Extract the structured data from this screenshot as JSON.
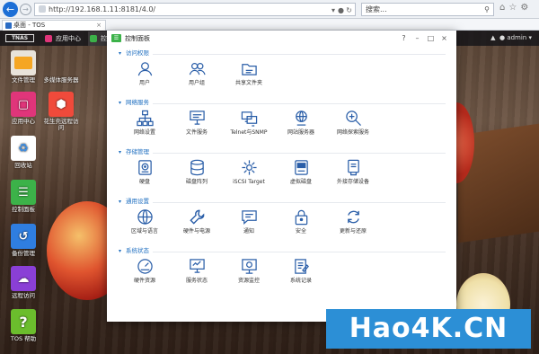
{
  "browser": {
    "url": "http://192.168.1.11:8181/4.0/",
    "search_placeholder": "搜索...",
    "tab_title": "桌面 - TOS"
  },
  "desktop": {
    "logo": "TERRAMASTER",
    "tabs": [
      {
        "label": "应用中心",
        "color": "#e0357a"
      },
      {
        "label": "控制面板",
        "color": "#3cb249"
      }
    ],
    "user": "admin",
    "icons": [
      {
        "label": "文件管理",
        "icon": "folder-icon",
        "color": "#f5a623"
      },
      {
        "label": "多媒体服务器",
        "icon": "media-server-icon",
        "color": "transparent"
      },
      {
        "label": "应用中心",
        "icon": "app-center-icon",
        "color": "#e0357a"
      },
      {
        "label": "花生壳远程访问",
        "icon": "peanut-shell-icon",
        "color": "#f04a3b"
      },
      {
        "label": "回收站",
        "icon": "recycle-bin-icon",
        "color": "#3a8ee6"
      },
      {
        "label": "控制面板",
        "icon": "control-panel-icon",
        "color": "#3cb249"
      },
      {
        "label": "备份管理",
        "icon": "backup-icon",
        "color": "#2f7ee0"
      },
      {
        "label": "远程访问",
        "icon": "cloud-icon",
        "color": "#8a3fd6"
      },
      {
        "label": "TOS 帮助",
        "icon": "help-icon",
        "color": "#6bbd2d"
      }
    ]
  },
  "window": {
    "title": "控制面板",
    "sections": [
      {
        "title": "访问权限",
        "items": [
          {
            "label": "用户",
            "icon": "user-icon"
          },
          {
            "label": "用户组",
            "icon": "user-group-icon"
          },
          {
            "label": "共享文件夹",
            "icon": "shared-folder-icon"
          }
        ]
      },
      {
        "title": "网络服务",
        "items": [
          {
            "label": "网络设置",
            "icon": "network-icon"
          },
          {
            "label": "文件服务",
            "icon": "file-service-icon"
          },
          {
            "label": "Telnet与SNMP",
            "icon": "telnet-icon"
          },
          {
            "label": "网站服务器",
            "icon": "web-server-icon"
          },
          {
            "label": "网络探索服务",
            "icon": "network-discovery-icon"
          }
        ]
      },
      {
        "title": "存储管理",
        "items": [
          {
            "label": "硬盘",
            "icon": "hard-disk-icon"
          },
          {
            "label": "磁盘阵列",
            "icon": "raid-icon"
          },
          {
            "label": "iSCSI Target",
            "icon": "iscsi-icon"
          },
          {
            "label": "虚拟磁盘",
            "icon": "virtual-disk-icon"
          },
          {
            "label": "外接存储设备",
            "icon": "external-storage-icon"
          }
        ]
      },
      {
        "title": "通用设置",
        "items": [
          {
            "label": "区域与语言",
            "icon": "globe-icon"
          },
          {
            "label": "硬件与电源",
            "icon": "wrench-icon"
          },
          {
            "label": "通知",
            "icon": "notification-icon"
          },
          {
            "label": "安全",
            "icon": "lock-icon"
          },
          {
            "label": "更新与还原",
            "icon": "update-icon"
          }
        ]
      },
      {
        "title": "系统状态",
        "items": [
          {
            "label": "硬件资源",
            "icon": "hardware-resource-icon"
          },
          {
            "label": "服务状态",
            "icon": "service-status-icon"
          },
          {
            "label": "资源监控",
            "icon": "resource-monitor-icon"
          },
          {
            "label": "系统记录",
            "icon": "system-log-icon"
          }
        ]
      }
    ]
  },
  "watermark": "Hao4K.CN"
}
